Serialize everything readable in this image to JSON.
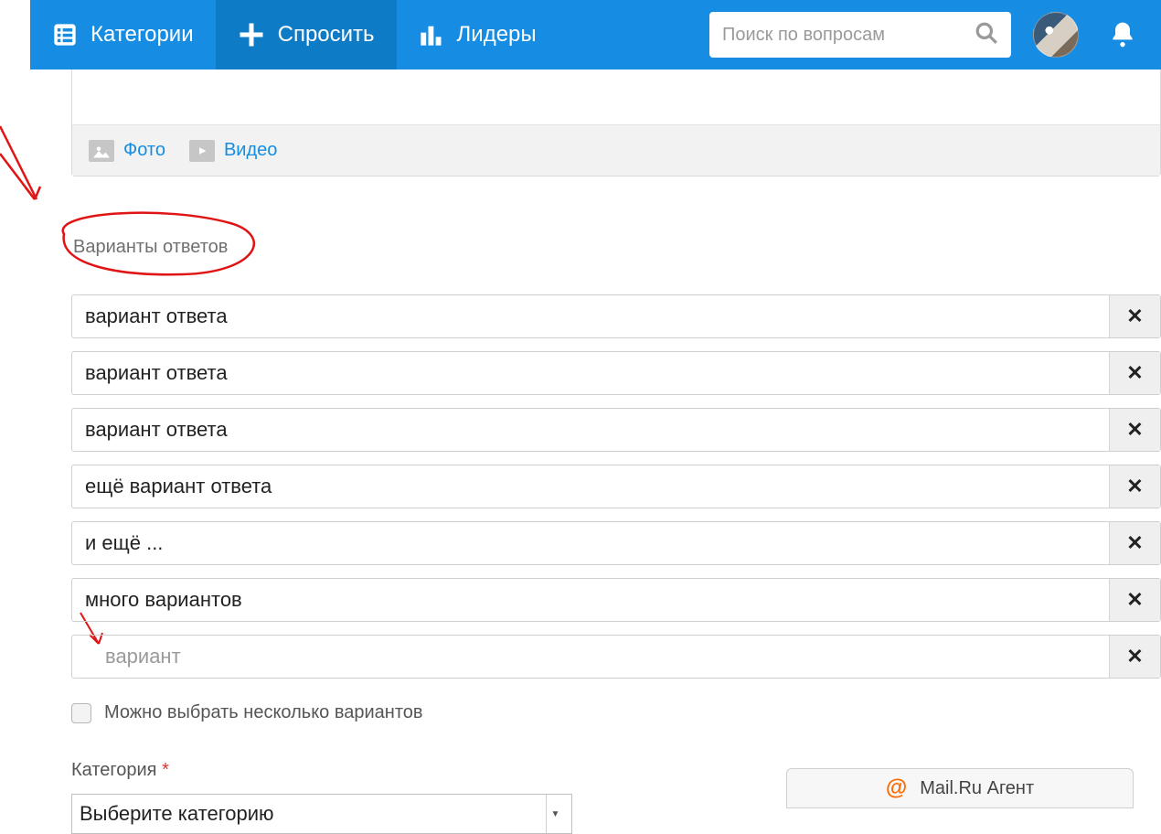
{
  "nav": {
    "categories": "Категории",
    "ask": "Спросить",
    "leaders": "Лидеры"
  },
  "search": {
    "placeholder": "Поиск по вопросам"
  },
  "compose": {
    "photo": "Фото",
    "video": "Видео"
  },
  "sections": {
    "answer_options": "Варианты ответов"
  },
  "options": [
    {
      "value": "вариант ответа"
    },
    {
      "value": "вариант ответа"
    },
    {
      "value": "вариант ответа"
    },
    {
      "value": "ещё вариант ответа"
    },
    {
      "value": "и ещё ..."
    },
    {
      "value": "много вариантов"
    }
  ],
  "empty_option_placeholder": "вариант",
  "multi_select_label": "Можно выбрать несколько вариантов",
  "category": {
    "label": "Категория",
    "required_mark": "*",
    "placeholder": "Выберите категорию"
  },
  "agent": {
    "label": "Mail.Ru Агент",
    "at": "@"
  }
}
